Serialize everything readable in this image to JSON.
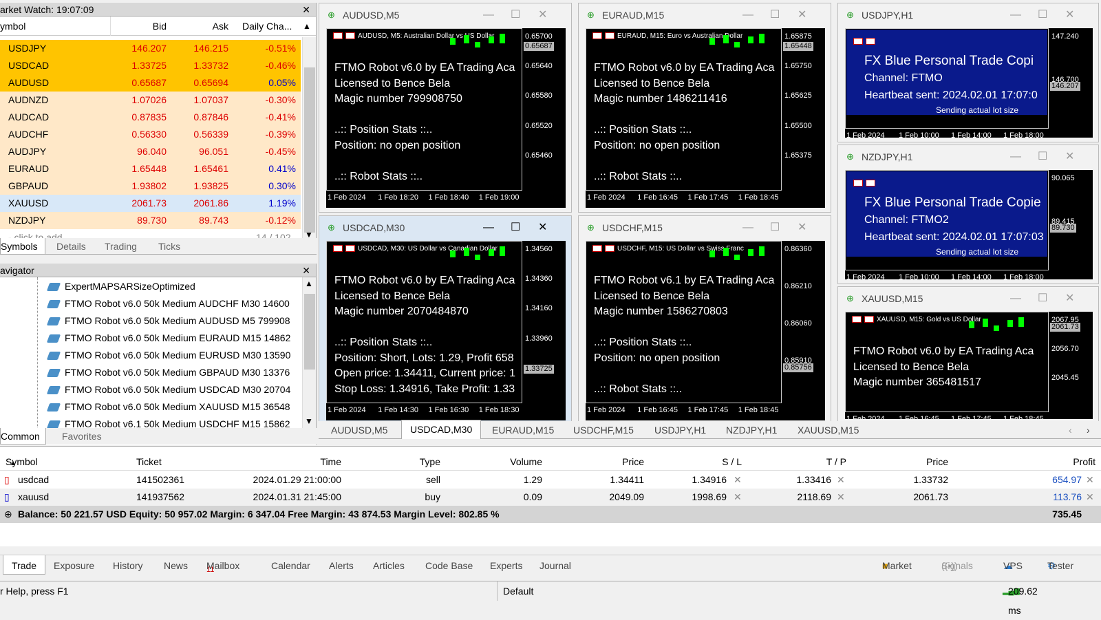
{
  "market_watch": {
    "title": "arket Watch: 19:07:09",
    "col_symbol": "ymbol",
    "col_bid": "Bid",
    "col_ask": "Ask",
    "col_change": "Daily Cha...",
    "rows": [
      {
        "symbol": "USDJPY",
        "bid": "146.207",
        "ask": "146.215",
        "change": "-0.51%",
        "bg": "#ffc400"
      },
      {
        "symbol": "USDCAD",
        "bid": "1.33725",
        "ask": "1.33732",
        "change": "-0.46%",
        "bg": "#ffc400"
      },
      {
        "symbol": "AUDUSD",
        "bid": "0.65687",
        "ask": "0.65694",
        "change": "0.05%",
        "bg": "#ffc400"
      },
      {
        "symbol": "AUDNZD",
        "bid": "1.07026",
        "ask": "1.07037",
        "change": "-0.30%",
        "bg": "#ffe8c8"
      },
      {
        "symbol": "AUDCAD",
        "bid": "0.87835",
        "ask": "0.87846",
        "change": "-0.41%",
        "bg": "#ffe8c8"
      },
      {
        "symbol": "AUDCHF",
        "bid": "0.56330",
        "ask": "0.56339",
        "change": "-0.39%",
        "bg": "#ffe8c8"
      },
      {
        "symbol": "AUDJPY",
        "bid": "96.040",
        "ask": "96.051",
        "change": "-0.45%",
        "bg": "#ffe8c8"
      },
      {
        "symbol": "EURAUD",
        "bid": "1.65448",
        "ask": "1.65461",
        "change": "0.41%",
        "bg": "#ffe8c8"
      },
      {
        "symbol": "GBPAUD",
        "bid": "1.93802",
        "ask": "1.93825",
        "change": "0.30%",
        "bg": "#ffe8c8"
      },
      {
        "symbol": "XAUUSD",
        "bid": "2061.73",
        "ask": "2061.86",
        "change": "1.19%",
        "bg": "#d8e8f8"
      },
      {
        "symbol": "NZDJPY",
        "bid": "89.730",
        "ask": "89.743",
        "change": "-0.12%",
        "bg": "#ffe8c8"
      }
    ],
    "add_row": "- click to add...",
    "count": "14 / 102",
    "tabs": [
      "Symbols",
      "Details",
      "Trading",
      "Ticks"
    ]
  },
  "navigator": {
    "title": "avigator",
    "items": [
      "ExpertMAPSARSizeOptimized",
      "FTMO Robot v6.0 50k Medium AUDCHF M30 14600",
      "FTMO Robot v6.0 50k Medium AUDUSD M5 799908",
      "FTMO Robot v6.0 50k Medium EURAUD M15 14862",
      "FTMO Robot v6.0 50k Medium EURUSD M30 13590",
      "FTMO Robot v6.0 50k Medium GBPAUD M30 13376",
      "FTMO Robot v6.0 50k Medium USDCAD M30 20704",
      "FTMO Robot v6.0 50k Medium XAUUSD M15 36548",
      "FTMO Robot v6.1 50k Medium USDCHF M15 15862"
    ],
    "tabs": [
      "Common",
      "Favorites"
    ]
  },
  "charts": [
    {
      "title": "AUDUSD,M5",
      "lines": [
        "FTMO Robot v6.0 by EA Trading Aca",
        "Licensed to Bence Bela",
        "Magic number 799908750",
        "",
        "..:: Position Stats ::..",
        "Position: no open position",
        "",
        "..:: Robot Stats ::.."
      ],
      "prices": [
        "0.65700",
        "0.65640",
        "0.65580",
        "0.65520",
        "0.65460"
      ],
      "price_box": "0.65687",
      "times": [
        "1 Feb 2024",
        "1 Feb 18:20",
        "1 Feb 18:40",
        "1 Feb 19:00"
      ],
      "header": "AUDUSD, M5: Australian Dollar vs US Dollar"
    },
    {
      "title": "EURAUD,M15",
      "lines": [
        "FTMO Robot v6.0 by EA Trading Aca",
        "Licensed to Bence Bela",
        "Magic number 1486211416",
        "",
        "..:: Position Stats ::..",
        "Position: no open position",
        "",
        "..:: Robot Stats ::.."
      ],
      "prices": [
        "1.65875",
        "1.65750",
        "1.65625",
        "1.65500",
        "1.65375"
      ],
      "price_box": "1.65448",
      "times": [
        "1 Feb 2024",
        "1 Feb 16:45",
        "1 Feb 17:45",
        "1 Feb 18:45"
      ],
      "header": "EURAUD, M15: Euro vs Australian Dollar"
    },
    {
      "title": "USDJPY,H1",
      "blue": [
        "FX Blue Personal Trade Copi",
        "Channel: FTMO",
        "Heartbeat sent: 2024.02.01 17:07:0"
      ],
      "sub": "Sending actual lot size",
      "prices": [
        "147.240",
        "146.700"
      ],
      "price_box": "146.207",
      "times": [
        "1 Feb 2024",
        "1 Feb 10:00",
        "1 Feb 14:00",
        "1 Feb 18:00"
      ]
    },
    {
      "title": "NZDJPY,H1",
      "blue": [
        "FX Blue Personal Trade Copie",
        "Channel: FTMO2",
        "Heartbeat sent: 2024.02.01 17:07:03"
      ],
      "sub": "Sending actual lot size",
      "prices": [
        "90.065",
        "89.415"
      ],
      "price_box": "89.730",
      "times": [
        "1 Feb 2024",
        "1 Feb 10:00",
        "1 Feb 14:00",
        "1 Feb 18:00"
      ]
    },
    {
      "title": "USDCAD,M30",
      "lines": [
        "FTMO Robot v6.0 by EA Trading Aca",
        "Licensed to Bence Bela",
        "Magic number 2070484870",
        "",
        "..:: Position Stats ::..",
        "Position: Short, Lots: 1.29, Profit 658",
        "Open price: 1.34411, Current price: 1",
        "Stop Loss: 1.34916, Take Profit: 1.33"
      ],
      "prices": [
        "1.34560",
        "1.34360",
        "1.34160",
        "1.33960",
        "1.33760"
      ],
      "price_box": "1.33725",
      "times": [
        "1 Feb 2024",
        "1 Feb 14:30",
        "1 Feb 16:30",
        "1 Feb 18:30"
      ],
      "header": "USDCAD, M30: US Dollar vs Canadian Dollar"
    },
    {
      "title": "USDCHF,M15",
      "lines": [
        "FTMO Robot v6.1 by EA Trading Aca",
        "Licensed to Bence Bela",
        "Magic number 1586270803",
        "",
        "..:: Position Stats ::..",
        "Position: no open position",
        "",
        "..:: Robot Stats ::.."
      ],
      "prices": [
        "0.86360",
        "0.86210",
        "0.86060",
        "0.85910"
      ],
      "price_box": "0.85756",
      "times": [
        "1 Feb 2024",
        "1 Feb 16:45",
        "1 Feb 17:45",
        "1 Feb 18:45"
      ],
      "header": "USDCHF, M15: US Dollar vs Swiss Franc"
    },
    {
      "title": "XAUUSD,M15",
      "lines": [
        "FTMO Robot v6.0 by EA Trading Aca",
        "Licensed to Bence Bela",
        "Magic number 365481517"
      ],
      "prices": [
        "2067.95",
        "2056.70",
        "2045.45"
      ],
      "price_box": "2061.73",
      "times": [
        "1 Feb 2024",
        "1 Feb 16:45",
        "1 Feb 17:45",
        "1 Feb 18:45"
      ],
      "header": "XAUUSD, M15: Gold vs US Dollar"
    }
  ],
  "chart_tabs": [
    "AUDUSD,M5",
    "USDCAD,M30",
    "EURAUD,M15",
    "USDCHF,M15",
    "USDJPY,H1",
    "NZDJPY,H1",
    "XAUUSD,M15"
  ],
  "trade": {
    "cols": [
      "Symbol",
      "Ticket",
      "Time",
      "Type",
      "Volume",
      "Price",
      "S / L",
      "T / P",
      "Price",
      "Profit"
    ],
    "rows": [
      {
        "symbol": "usdcad",
        "ticket": "141502361",
        "time": "2024.01.29 21:00:00",
        "type": "sell",
        "volume": "1.29",
        "price": "1.34411",
        "sl": "1.34916",
        "tp": "1.33416",
        "cur": "1.33732",
        "profit": "654.97"
      },
      {
        "symbol": "xauusd",
        "ticket": "141937562",
        "time": "2024.01.31 21:45:00",
        "type": "buy",
        "volume": "0.09",
        "price": "2049.09",
        "sl": "1998.69",
        "tp": "2118.69",
        "cur": "2061.73",
        "profit": "113.76"
      }
    ],
    "summary": "Balance: 50 221.57 USD  Equity: 50 957.02  Margin: 6 347.04  Free Margin: 43 874.53  Margin Level: 802.85 %",
    "total": "735.45"
  },
  "bottom_tabs": [
    "Trade",
    "Exposure",
    "History",
    "News",
    "Mailbox",
    "Calendar",
    "Alerts",
    "Articles",
    "Code Base",
    "Experts",
    "Journal"
  ],
  "mailbox_count": "11",
  "right_tabs": [
    "Market",
    "Signals",
    "VPS",
    "Tester"
  ],
  "status": {
    "help": "r Help, press F1",
    "profile": "Default",
    "ping": "209.62 ms"
  }
}
